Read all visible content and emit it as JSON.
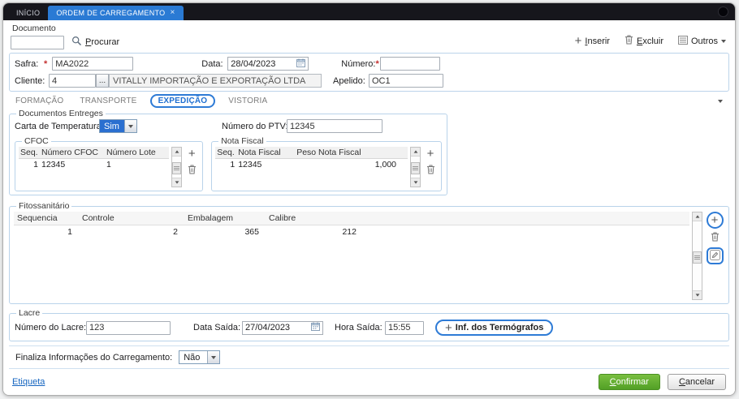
{
  "titlebar": {
    "tabs": [
      {
        "label": "INÍCIO"
      },
      {
        "label": "ORDEM DE CARREGAMENTO",
        "close_icon": "×"
      }
    ]
  },
  "toolbar": {
    "documento_label": "Documento",
    "documento_value": "",
    "procurar": "Procurar",
    "inserir": "Inserir",
    "excluir": "Excluir",
    "outros": "Outros"
  },
  "header": {
    "safra_label": "Safra:",
    "required_mark": "*",
    "safra_value": "MA2022",
    "data_label": "Data:",
    "data_value": "28/04/2023",
    "numero_label": "Número:",
    "numero_value": "",
    "cliente_label": "Cliente:",
    "cliente_code": "4",
    "cliente_lookup": "...",
    "cliente_name": "VITALLY IMPORTAÇÃO E EXPORTAÇÃO LTDA",
    "apelido_label": "Apelido:",
    "apelido_value": "OC1"
  },
  "tabs": {
    "formacao": "FORMAÇÃO",
    "transporte": "TRANSPORTE",
    "expedicao": "EXPEDIÇÃO",
    "vistoria": "VISTORIA"
  },
  "documentos": {
    "title": "Documentos Entreges",
    "carta_label": "Carta de Temperatura:",
    "carta_value": "Sim",
    "ptv_label": "Número do PTV:",
    "ptv_value": "12345",
    "cfoc": {
      "title": "CFOC",
      "headers": [
        "Seq.",
        "Número CFOC",
        "Número Lote"
      ],
      "row": [
        "1",
        "12345",
        "1"
      ]
    },
    "nota_fiscal": {
      "title": "Nota Fiscal",
      "headers": [
        "Seq.",
        "Nota Fiscal",
        "Peso Nota Fiscal"
      ],
      "row": [
        "1",
        "12345",
        "1,000"
      ]
    }
  },
  "fitossanitario": {
    "title": "Fitossanitário",
    "headers": [
      "Sequencia",
      "Controle",
      "Embalagem",
      "Calibre"
    ],
    "row": [
      "1",
      "2",
      "365",
      "212"
    ]
  },
  "lacre": {
    "title": "Lacre",
    "numero_label": "Número do Lacre:",
    "numero_value": "123",
    "data_label": "Data Saída:",
    "data_value": "27/04/2023",
    "hora_label": "Hora Saída:",
    "hora_value": "15:55",
    "termografos": "Inf. dos Termógrafos"
  },
  "finaliza": {
    "label": "Finaliza Informações do Carregamento:",
    "value": "Não"
  },
  "footer": {
    "etiqueta": "Etiqueta",
    "confirmar": "Confirmar",
    "cancelar": "Cancelar"
  },
  "icons": {
    "plus": "+"
  },
  "colors": {
    "accent_blue": "#2a7ad4",
    "annotation_blue": "#2e7bd6",
    "required_pink": "#f7dedd",
    "confirm_green": "#52a026"
  }
}
